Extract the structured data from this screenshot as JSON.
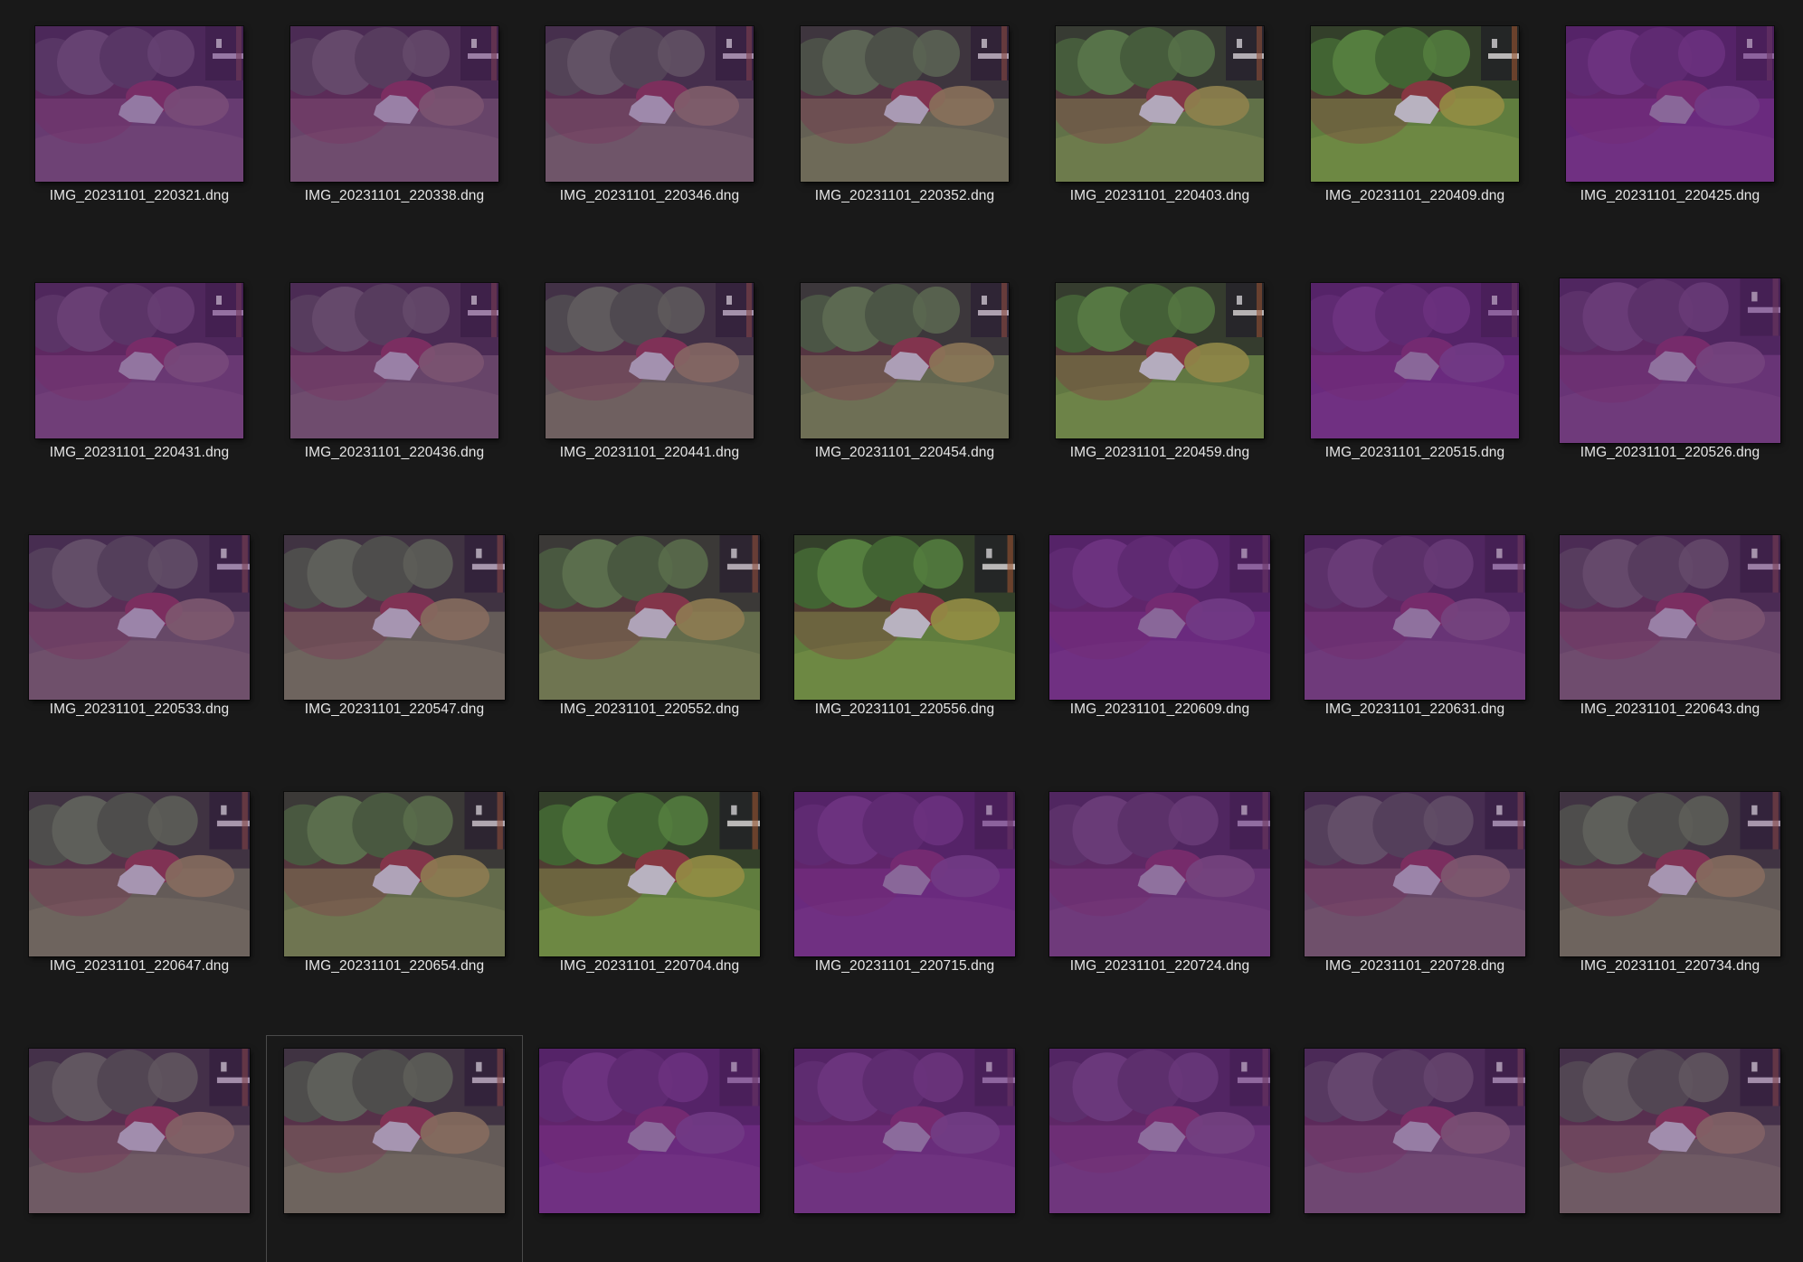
{
  "window": {
    "view": "large-icons",
    "background": "#191919"
  },
  "files": [
    {
      "name": "IMG_20231101_220321.dng",
      "tint": "purple",
      "level": 0.25
    },
    {
      "name": "IMG_20231101_220338.dng",
      "tint": "purple",
      "level": 0.35
    },
    {
      "name": "IMG_20231101_220346.dng",
      "tint": "green",
      "level": 0.45
    },
    {
      "name": "IMG_20231101_220352.dng",
      "tint": "green",
      "level": 0.65
    },
    {
      "name": "IMG_20231101_220403.dng",
      "tint": "green",
      "level": 0.8
    },
    {
      "name": "IMG_20231101_220409.dng",
      "tint": "green",
      "level": 0.9
    },
    {
      "name": "IMG_20231101_220425.dng",
      "tint": "purple",
      "level": 0.0
    },
    {
      "name": "IMG_20231101_220431.dng",
      "tint": "purple",
      "level": 0.2
    },
    {
      "name": "IMG_20231101_220436.dng",
      "tint": "purple",
      "level": 0.35
    },
    {
      "name": "IMG_20231101_220441.dng",
      "tint": "green",
      "level": 0.55
    },
    {
      "name": "IMG_20231101_220454.dng",
      "tint": "green",
      "level": 0.7
    },
    {
      "name": "IMG_20231101_220459.dng",
      "tint": "green",
      "level": 0.85
    },
    {
      "name": "IMG_20231101_220515.dng",
      "tint": "purple",
      "level": 0.0
    },
    {
      "name": "IMG_20231101_220526.dng",
      "tint": "purple",
      "level": 0.15
    },
    {
      "name": "IMG_20231101_220533.dng",
      "tint": "mixed",
      "level": 0.4
    },
    {
      "name": "IMG_20231101_220547.dng",
      "tint": "green",
      "level": 0.6
    },
    {
      "name": "IMG_20231101_220552.dng",
      "tint": "green",
      "level": 0.75
    },
    {
      "name": "IMG_20231101_220556.dng",
      "tint": "green",
      "level": 0.9
    },
    {
      "name": "IMG_20231101_220609.dng",
      "tint": "purple",
      "level": 0.0
    },
    {
      "name": "IMG_20231101_220631.dng",
      "tint": "purple",
      "level": 0.15
    },
    {
      "name": "IMG_20231101_220643.dng",
      "tint": "mixed",
      "level": 0.35
    },
    {
      "name": "IMG_20231101_220647.dng",
      "tint": "green",
      "level": 0.6
    },
    {
      "name": "IMG_20231101_220654.dng",
      "tint": "green",
      "level": 0.75
    },
    {
      "name": "IMG_20231101_220704.dng",
      "tint": "green",
      "level": 0.9
    },
    {
      "name": "IMG_20231101_220715.dng",
      "tint": "purple",
      "level": 0.0
    },
    {
      "name": "IMG_20231101_220724.dng",
      "tint": "purple",
      "level": 0.15
    },
    {
      "name": "IMG_20231101_220728.dng",
      "tint": "mixed",
      "level": 0.4
    },
    {
      "name": "IMG_20231101_220734.dng",
      "tint": "green",
      "level": 0.6
    },
    {
      "name": "",
      "tint": "green",
      "level": 0.5
    },
    {
      "name": "",
      "tint": "green",
      "level": 0.6
    },
    {
      "name": "",
      "tint": "purple",
      "level": 0.0
    },
    {
      "name": "",
      "tint": "purple",
      "level": 0.05
    },
    {
      "name": "",
      "tint": "purple",
      "level": 0.1
    },
    {
      "name": "",
      "tint": "mixed",
      "level": 0.3
    },
    {
      "name": "",
      "tint": "green",
      "level": 0.5
    }
  ],
  "hovered_index": 29,
  "colors": {
    "caption": "#e6e6e6",
    "purple": "#6a2a7e",
    "green": "#5f8a35",
    "rock": "#bfbcc6"
  }
}
